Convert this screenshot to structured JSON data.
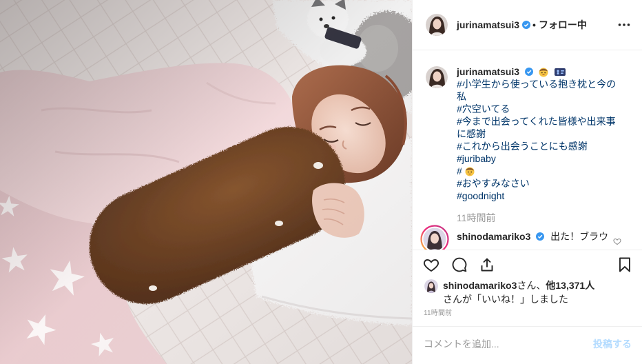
{
  "colors": {
    "text": "#262626",
    "hashtag": "#003569",
    "muted": "#999999",
    "verified": "#3897f0",
    "post_button_disabled": "#b3dbff",
    "divider": "#efefef"
  },
  "header": {
    "username": "jurinamatsui3",
    "verified_icon": "verified-badge",
    "separator": "•",
    "follow_status": "フォロー中",
    "more_icon": "more-horizontal"
  },
  "caption": {
    "username": "jurinamatsui3",
    "verified_icon": "verified-badge",
    "emoji_icons": [
      "baby-emoji",
      "baby-symbol-emoji"
    ],
    "hashtags": [
      {
        "text": "#小学生から使っている抱き枕と今の私"
      },
      {
        "text": "#穴空いてる"
      },
      {
        "text": "#今まで出会ってくれた皆様や出来事に感謝"
      },
      {
        "text": "#これから出会うことにも感謝"
      },
      {
        "text": "#juribaby"
      },
      {
        "text": "#",
        "emoji_icon": "baby-emoji"
      },
      {
        "text": "#おやすみなさい"
      },
      {
        "text": "#goodnight"
      }
    ],
    "timestamp": "11時間前"
  },
  "comments": [
    {
      "username": "shinodamariko3",
      "verified_icon": "verified-badge",
      "text": "出た！ブラウ",
      "like_icon": "heart-outline"
    }
  ],
  "actions": {
    "like_icon": "heart-outline",
    "comment_icon": "comment-bubble",
    "share_icon": "share-upload",
    "save_icon": "bookmark-outline"
  },
  "likes": {
    "first_user": "shinodamariko3",
    "first_user_suffix": "さん、",
    "others_count": "他13,371人",
    "suffix_line": "さんが「いいね！」しました"
  },
  "post_timestamp": "11時間前",
  "add_comment": {
    "placeholder": "コメントを追加...",
    "post_label": "投稿する"
  }
}
